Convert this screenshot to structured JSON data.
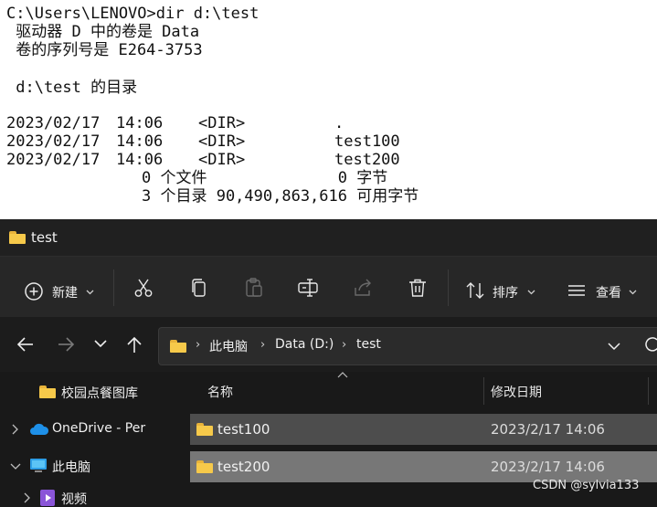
{
  "console": {
    "command": "C:\\Users\\LENOVO>dir d:\\test",
    "volume_line": " 驱动器 D 中的卷是 Data",
    "serial_line": " 卷的序列号是 E264-3753",
    "dir_of_line": " d:\\test 的目录",
    "entries": [
      {
        "date": "2023/02/17",
        "time": "14:06",
        "type": "<DIR>",
        "name": "."
      },
      {
        "date": "2023/02/17",
        "time": "14:06",
        "type": "<DIR>",
        "name": "test100"
      },
      {
        "date": "2023/02/17",
        "time": "14:06",
        "type": "<DIR>",
        "name": "test200"
      }
    ],
    "files_summary": "0 个文件              0 字节",
    "dirs_summary": "3 个目录 90,490,863,616 可用字节"
  },
  "explorer": {
    "title": "test",
    "toolbar": {
      "new_label": "新建",
      "sort_label": "排序",
      "view_label": "查看"
    },
    "breadcrumb": [
      "此电脑",
      "Data (D:)",
      "test"
    ],
    "sidebar": {
      "items": [
        {
          "label": "校园点餐图库",
          "icon": "folder-icon"
        },
        {
          "label": "OneDrive - Per",
          "icon": "onedrive-cloud-icon"
        },
        {
          "label": "此电脑",
          "icon": "computer-icon"
        },
        {
          "label": "视频",
          "icon": "video-icon"
        }
      ]
    },
    "columns": {
      "name": "名称",
      "modified": "修改日期"
    },
    "files": [
      {
        "name": "test100",
        "modified": "2023/2/17 14:06"
      },
      {
        "name": "test200",
        "modified": "2023/2/17 14:06"
      }
    ],
    "colors": {
      "folder": "#f6c94a",
      "selection": "#777777",
      "hover": "#4d4d4d",
      "accent": "#4cc2ff"
    }
  },
  "watermark": "CSDN @sylvia133"
}
